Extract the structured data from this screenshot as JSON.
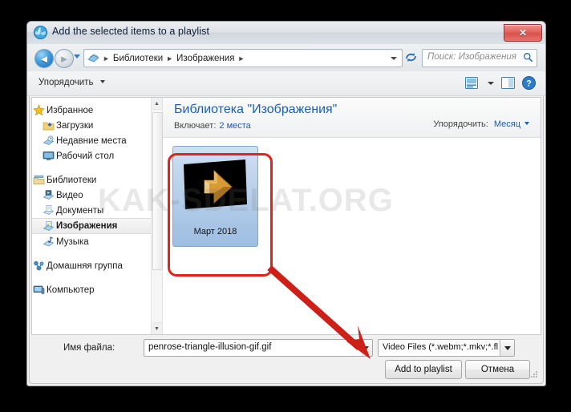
{
  "window": {
    "title": "Add the selected items to a playlist",
    "title_icon": "vlc-cone-globe-icon",
    "close_label": "✕"
  },
  "navbar": {
    "back_icon": "back-arrow-icon",
    "forward_icon": "forward-arrow-icon",
    "recent_caret_icon": "chevron-down-icon",
    "address_icon": "libraries-icon",
    "breadcrumbs": [
      "Библиотеки",
      "Изображения"
    ],
    "breadcrumb_sep": "►",
    "refresh_icon": "refresh-icon",
    "search_placeholder": "Поиск: Изображения",
    "search_icon": "search-icon"
  },
  "toolbar": {
    "organize_label": "Упорядочить",
    "view_icon": "view-mode-icon",
    "view_caret_icon": "chevron-down-icon",
    "preview_pane_icon": "preview-pane-icon",
    "help_icon": "help-icon"
  },
  "navpane": {
    "items": [
      {
        "label": "Избранное",
        "level": "root",
        "icon": "star-icon"
      },
      {
        "label": "Загрузки",
        "level": "child",
        "icon": "downloads-folder-icon"
      },
      {
        "label": "Недавние места",
        "level": "child",
        "icon": "recent-places-icon"
      },
      {
        "label": "Рабочий стол",
        "level": "child",
        "icon": "desktop-icon"
      },
      {
        "label": "",
        "level": "gap",
        "icon": ""
      },
      {
        "label": "Библиотеки",
        "level": "root",
        "icon": "libraries-icon"
      },
      {
        "label": "Видео",
        "level": "child",
        "icon": "video-library-icon"
      },
      {
        "label": "Документы",
        "level": "child",
        "icon": "documents-library-icon"
      },
      {
        "label": "Изображения",
        "level": "child",
        "icon": "pictures-library-icon",
        "selected": true
      },
      {
        "label": "Музыка",
        "level": "child",
        "icon": "music-library-icon"
      },
      {
        "label": "",
        "level": "gap",
        "icon": ""
      },
      {
        "label": "Домашняя группа",
        "level": "root",
        "icon": "homegroup-icon"
      },
      {
        "label": "",
        "level": "gap",
        "icon": ""
      },
      {
        "label": "Компьютер",
        "level": "root",
        "icon": "computer-icon"
      }
    ],
    "scrollbar_up_icon": "chevron-up-icon",
    "scrollbar_down_icon": "chevron-down-icon"
  },
  "library": {
    "title": "Библиотека \"Изображения\"",
    "includes_label": "Включает:",
    "includes_value": "2 места",
    "arrange_label": "Упорядочить:",
    "arrange_value": "Месяц"
  },
  "items": [
    {
      "label": "Март 2018",
      "selected": true,
      "thumb": "penrose-triangle-illusion-thumbnail"
    }
  ],
  "bottom": {
    "filename_label": "Имя файла:",
    "filename_value": "penrose-triangle-illusion-gif.gif",
    "filetype_value": "Video Files (*.webm;*.mkv;*.flv",
    "submit_label": "Add to playlist",
    "cancel_label": "Отмена"
  },
  "annotation": {
    "watermark": "KAK-SDELAT.ORG",
    "highlight_color": "#e4221c",
    "arrow_color": "#cc2018"
  }
}
